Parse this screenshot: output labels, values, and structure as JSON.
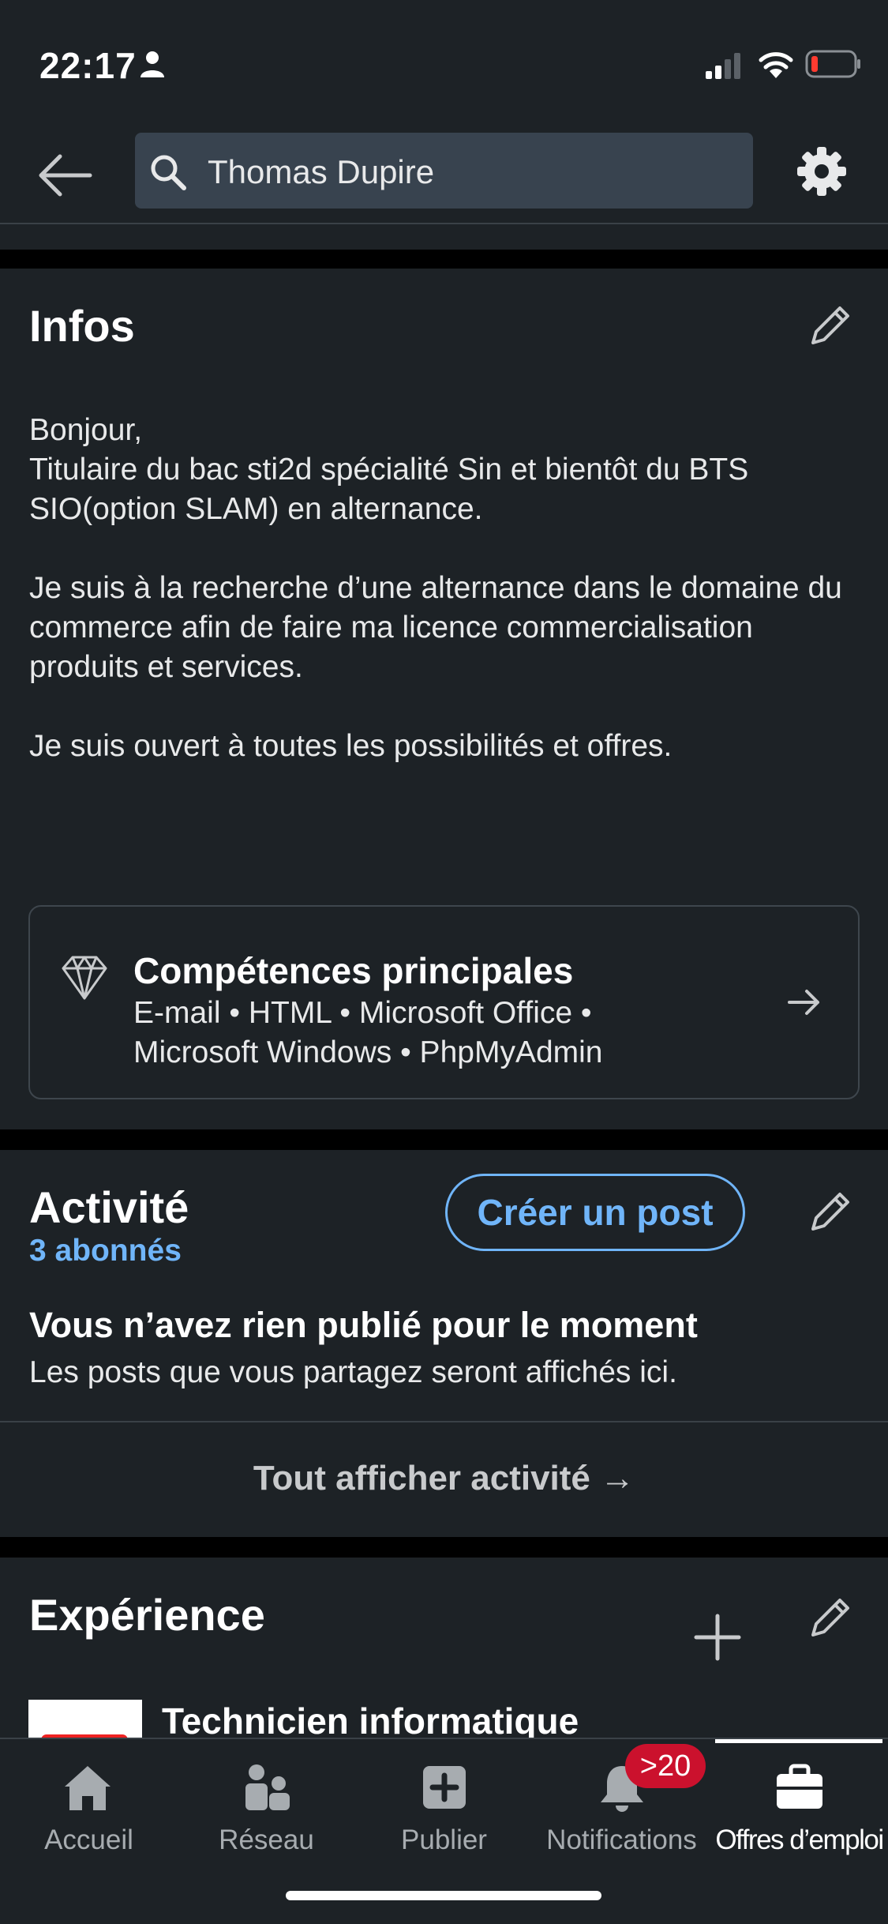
{
  "status_bar": {
    "time": "22:17",
    "icons": [
      "person-icon",
      "signal-icon",
      "wifi-icon",
      "battery-icon"
    ]
  },
  "header": {
    "search_value": "Thomas Dupire",
    "icons": [
      "back-icon",
      "search-icon",
      "gear-icon"
    ]
  },
  "infos": {
    "title": "Infos",
    "paragraphs": [
      "Bonjour,\nTitulaire du bac sti2d spécialité Sin et bientôt du BTS SIO(option SLAM) en alternance.",
      "Je suis à la recherche d’une alternance dans le domaine du commerce afin de faire ma licence commercialisation produits et services.",
      "Je suis ouvert à toutes les possibilités et offres."
    ],
    "skills": {
      "title": "Compétences principales",
      "list": "E-mail • HTML • Microsoft Office • Microsoft Windows • PhpMyAdmin"
    }
  },
  "activity": {
    "title": "Activité",
    "followers": "3 abonnés",
    "create_post_label": "Créer un post",
    "empty_title": "Vous n’avez rien publié pour le moment",
    "empty_desc": "Les posts que vous partagez seront affichés ici.",
    "show_all_label": "Tout afficher activité →"
  },
  "experience": {
    "title": "Expérience",
    "first_job_title": "Technicien informatique"
  },
  "bottom_nav": {
    "items": [
      {
        "label": "Accueil",
        "icon": "home-icon"
      },
      {
        "label": "Réseau",
        "icon": "network-icon"
      },
      {
        "label": "Publier",
        "icon": "post-icon"
      },
      {
        "label": "Notifications",
        "icon": "bell-icon"
      },
      {
        "label": "Offres d’emploi",
        "icon": "briefcase-icon"
      }
    ],
    "notifications_badge": ">20",
    "active_index": 4
  },
  "colors": {
    "background": "#1d2226",
    "accent": "#70b5f9",
    "badge": "#cb112d"
  }
}
